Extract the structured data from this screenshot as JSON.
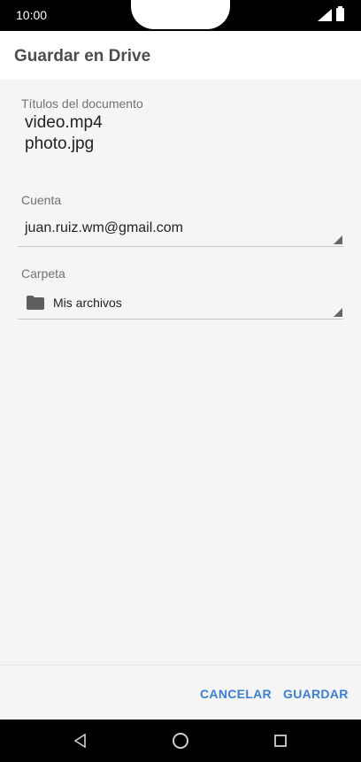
{
  "status_bar": {
    "time": "10:00"
  },
  "header": {
    "title": "Guardar en Drive"
  },
  "documents": {
    "label": "Títulos del documento",
    "titles": [
      "video.mp4",
      "photo.jpg"
    ]
  },
  "account": {
    "label": "Cuenta",
    "value": "juan.ruiz.wm@gmail.com"
  },
  "folder": {
    "label": "Carpeta",
    "value": "Mis archivos",
    "icon": "folder-icon"
  },
  "footer": {
    "cancel_label": "CANCELAR",
    "save_label": "GUARDAR"
  },
  "colors": {
    "accent": "#3b7fd4",
    "header_bg": "#ffffff",
    "content_bg": "#f5f5f5"
  },
  "navigation": {
    "back_icon": "back-triangle-icon",
    "home_icon": "home-circle-icon",
    "recents_icon": "recents-square-icon"
  }
}
